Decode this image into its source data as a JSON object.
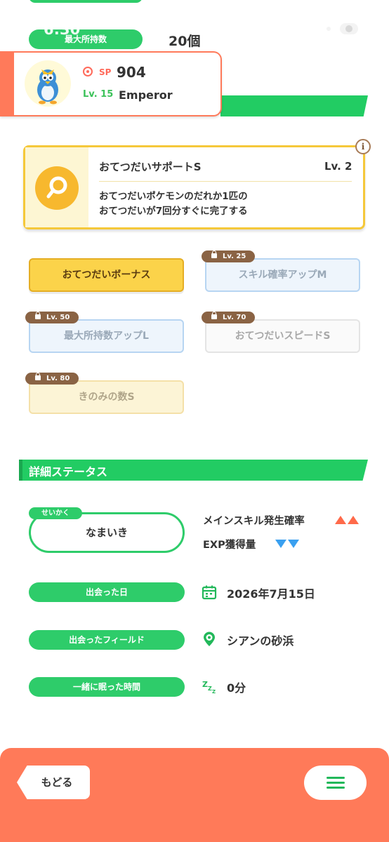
{
  "header": {
    "status_time": "6:30",
    "max_label": "最大所持数",
    "max_count": "20個"
  },
  "pokemon": {
    "sp_label": "SP",
    "sp_value": "904",
    "level": "Lv. 15",
    "name": "Emperor",
    "avatar_icon": "prinplup-avatar-icon"
  },
  "main_skill": {
    "name": "おてつだいサポートS",
    "level": "Lv. 2",
    "description_line1": "おてつだいポケモンのだれか1匹の",
    "description_line2": "おてつだいが7回分すぐに完了する",
    "info_label": "i"
  },
  "sub_skills": [
    {
      "label": "おてつだいボーナス",
      "unlocked": true
    },
    {
      "label": "スキル確率アップM",
      "lock_level": "Lv. 25"
    },
    {
      "label": "最大所持数アップL",
      "lock_level": "Lv. 50"
    },
    {
      "label": "おてつだいスピードS",
      "lock_level": "Lv. 70"
    },
    {
      "label": "きのみの数S",
      "lock_level": "Lv. 80"
    }
  ],
  "details": {
    "section_title": "詳細ステータス",
    "nature_tag": "せいかく",
    "nature": "なまいき",
    "up_effect": "メインスキル発生確率",
    "down_effect": "EXP獲得量",
    "met_date_label": "出会った日",
    "met_date": "2026年7月15日",
    "met_field_label": "出会ったフィールド",
    "met_field": "シアンの砂浜",
    "sleep_label": "一緒に眠った時間",
    "sleep_time": "0分",
    "sleep_icon": "Zzz"
  },
  "footer": {
    "back_label": "もどる"
  },
  "colors": {
    "green": "#2ecc6a",
    "coral": "#ff7a59",
    "gold": "#fbd34a"
  }
}
